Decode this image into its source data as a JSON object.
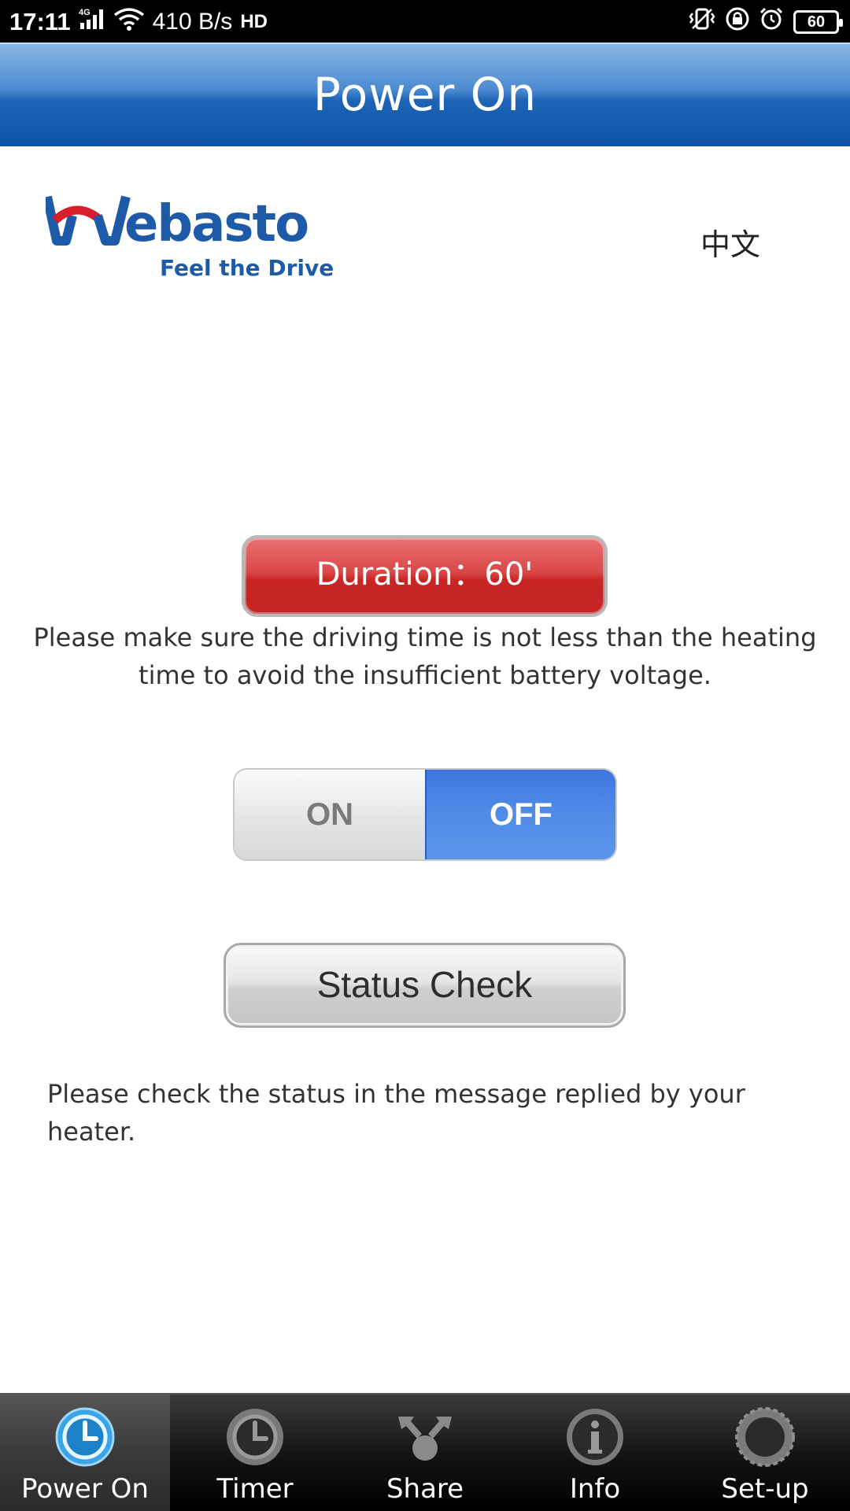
{
  "status_bar": {
    "time": "17:11",
    "network": "4G",
    "speed": "410 B/s",
    "hd": "HD",
    "battery": "60",
    "icons": [
      "signal-icon",
      "wifi-icon",
      "vibrate-icon",
      "lock-icon",
      "alarm-icon",
      "battery-icon"
    ]
  },
  "header": {
    "title": "Power On"
  },
  "logo": {
    "brand": "Webasto",
    "tagline": "Feel the Drive"
  },
  "language_link": "中文",
  "duration_button": {
    "label": "Duration：60'"
  },
  "warning_text": "Please make sure the driving time is not less than the heating time to avoid the insufficient battery voltage.",
  "toggle": {
    "on_label": "ON",
    "off_label": "OFF",
    "selected": "OFF"
  },
  "status_check_button": {
    "label": "Status Check"
  },
  "check_text": "Please check the status in the message replied by your heater.",
  "tabs": [
    {
      "label": "Power On",
      "icon": "power-on-clock-icon",
      "active": true
    },
    {
      "label": "Timer",
      "icon": "timer-clock-icon",
      "active": false
    },
    {
      "label": "Share",
      "icon": "share-icon",
      "active": false
    },
    {
      "label": "Info",
      "icon": "info-icon",
      "active": false
    },
    {
      "label": "Set-up",
      "icon": "setup-gear-icon",
      "active": false
    }
  ],
  "colors": {
    "header_blue": "#1d63b6",
    "duration_red": "#c92525",
    "toggle_blue": "#4f8ae6",
    "active_tab_icon": "#39a4e6"
  }
}
